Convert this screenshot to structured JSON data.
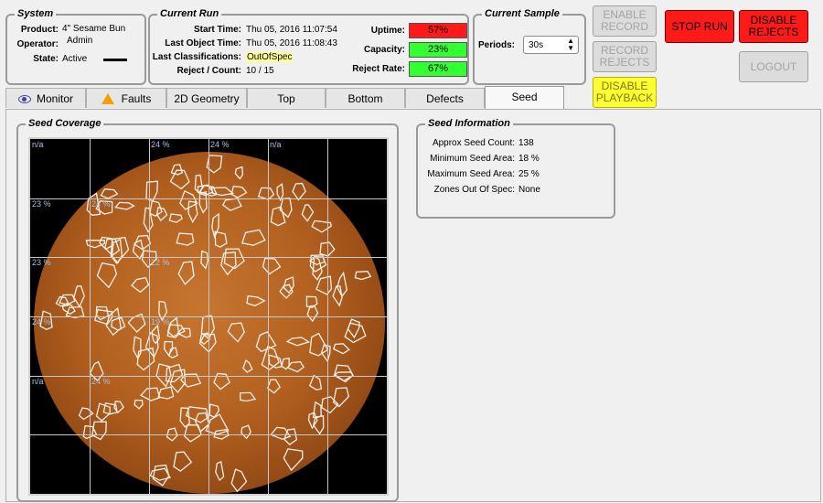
{
  "system": {
    "title": "System",
    "product_label": "Product:",
    "product_value": "4\" Sesame Bun",
    "operator_label": "Operator:",
    "operator_value": "Admin",
    "state_label": "State:",
    "state_value": "Active"
  },
  "current_run": {
    "title": "Current Run",
    "start_time_label": "Start Time:",
    "start_time_value": "Thu 05, 2016 11:07:54",
    "last_object_label": "Last Object Time:",
    "last_object_value": "Thu 05, 2016 11:08:43",
    "last_class_label": "Last Classifications:",
    "last_class_value": "OutOfSpec",
    "reject_count_label": "Reject / Count:",
    "reject_count_value": "10 / 15",
    "uptime_label": "Uptime:",
    "uptime_value": "57%",
    "capacity_label": "Capacity:",
    "capacity_value": "23%",
    "reject_rate_label": "Reject Rate:",
    "reject_rate_value": "67%",
    "colors": {
      "uptime": "#ff1a1a",
      "capacity": "#33ff33",
      "reject_rate": "#33ff33"
    }
  },
  "current_sample": {
    "title": "Current Sample",
    "periods_label": "Periods:",
    "periods_value": "30s"
  },
  "buttons": {
    "enable_record": "ENABLE RECORD",
    "record_rejects": "RECORD REJECTS",
    "disable_playback": "DISABLE PLAYBACK",
    "stop_run": "STOP RUN",
    "disable_rejects": "DISABLE REJECTS",
    "logout": "LOGOUT"
  },
  "tabs": [
    {
      "label": "Monitor",
      "icon": "eye-icon"
    },
    {
      "label": "Faults",
      "icon": "warning-icon"
    },
    {
      "label": "2D Geometry"
    },
    {
      "label": "Top"
    },
    {
      "label": "Bottom"
    },
    {
      "label": "Defects"
    },
    {
      "label": "Seed",
      "active": true
    }
  ],
  "seed_coverage": {
    "title": "Seed Coverage",
    "zones": [
      [
        "n/a",
        "",
        "24 %",
        "24 %",
        "n/a",
        "",
        ""
      ],
      [
        "23 %",
        "24 %",
        "",
        "",
        "",
        "",
        ""
      ],
      [
        "23 %",
        "",
        "22 %",
        "",
        "",
        "",
        ""
      ],
      [
        "24 %",
        "",
        "19 %",
        "",
        "",
        "",
        ""
      ],
      [
        "n/a",
        "24 %",
        "",
        "",
        "",
        "",
        ""
      ]
    ]
  },
  "seed_information": {
    "title": "Seed Information",
    "rows": [
      {
        "label": "Approx Seed Count:",
        "value": "138"
      },
      {
        "label": "Minimum Seed Area:",
        "value": "18 %"
      },
      {
        "label": "Maximum Seed Area:",
        "value": "25 %"
      },
      {
        "label": "Zones Out Of Spec:",
        "value": "None"
      }
    ]
  }
}
